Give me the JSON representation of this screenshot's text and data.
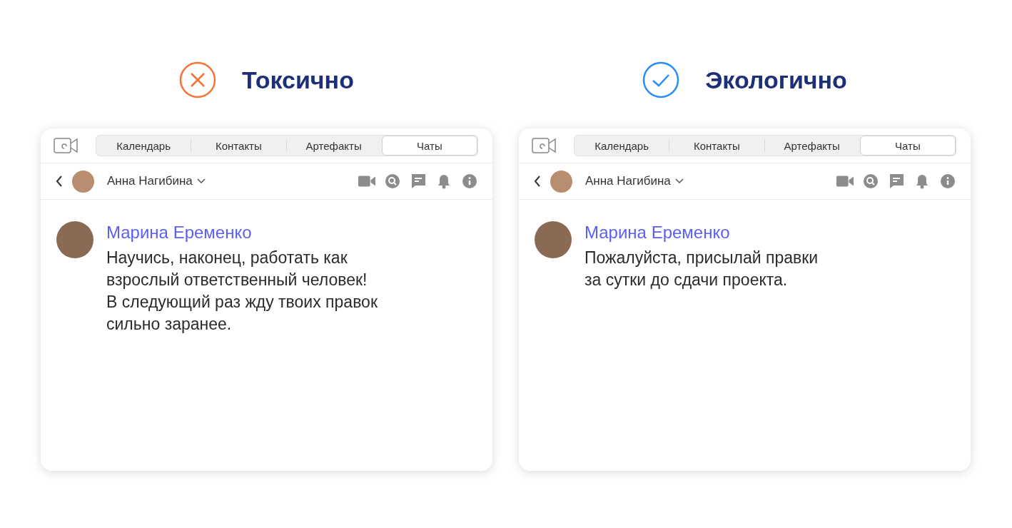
{
  "panels": [
    {
      "verdict": {
        "kind": "bad",
        "title": "Токсично"
      },
      "tabs": [
        {
          "label": "Календарь",
          "selected": false
        },
        {
          "label": "Контакты",
          "selected": false
        },
        {
          "label": "Артефакты",
          "selected": false
        },
        {
          "label": "Чаты",
          "selected": true
        }
      ],
      "contact": "Анна Нагибина",
      "message": {
        "author": "Марина Еременко",
        "text": "Научись, наконец, работать как\nвзрослый ответственный человек!\nВ следующий раз жду твоих правок\nсильно заранее."
      }
    },
    {
      "verdict": {
        "kind": "good",
        "title": "Экологично"
      },
      "tabs": [
        {
          "label": "Календарь",
          "selected": false
        },
        {
          "label": "Контакты",
          "selected": false
        },
        {
          "label": "Артефакты",
          "selected": false
        },
        {
          "label": "Чаты",
          "selected": true
        }
      ],
      "contact": "Анна Нагибина",
      "message": {
        "author": "Марина Еременко",
        "text": "Пожалуйста, присылай правки\nза сутки до сдачи проекта."
      }
    }
  ]
}
